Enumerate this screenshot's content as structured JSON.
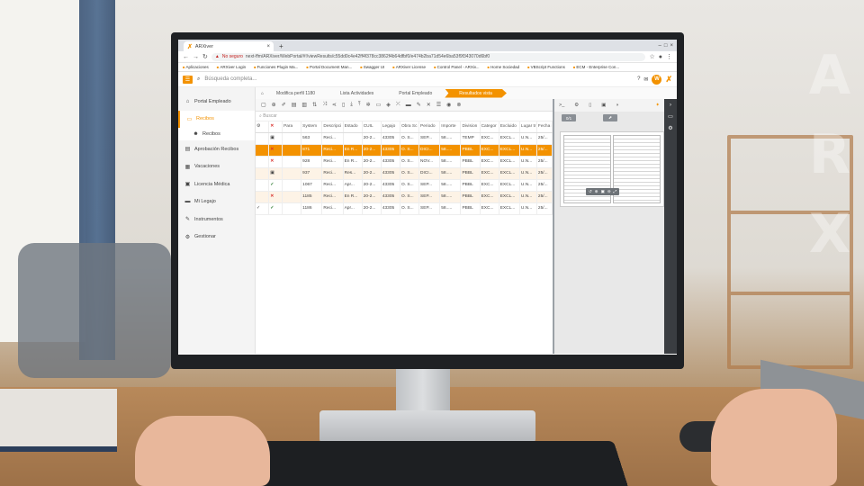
{
  "browser": {
    "tab_title": "ARXiver",
    "not_secure": "No seguro",
    "url": "next-ffm/ARXiver/WebPortal/#!/viewResults/c55dd0c4e42ff4f378cc3862f4b64dfbf0/e474b2ba71d54e6ba53f9f343070d6bf0",
    "bookmarks": [
      "Aplicaciones",
      "ARXiver Login",
      "Funciones Plugin Ma...",
      "Portal Document Man...",
      "Swagger UI",
      "ARXiver License",
      "Control Panel - ARXiv...",
      "Home Sociedad",
      "VBScript Functions",
      "ECM - Enterprise Con..."
    ]
  },
  "header": {
    "search_placeholder": "Búsqueda completa...",
    "avatar_letter": "W"
  },
  "sidebar": {
    "items": [
      {
        "label": "Portal Empleado",
        "icon": "home-icon"
      },
      {
        "label": "Recibos",
        "icon": "folder-icon",
        "active": true
      },
      {
        "label": "Aprobación Recibos",
        "icon": "approval-icon"
      },
      {
        "label": "Vacaciones",
        "icon": "calendar-icon"
      },
      {
        "label": "Licencia Médica",
        "icon": "medical-icon"
      },
      {
        "label": "Mi Legajo",
        "icon": "file-icon"
      },
      {
        "label": "Instrumentos",
        "icon": "wrench-icon"
      },
      {
        "label": "Gestionar",
        "icon": "gears-icon"
      }
    ],
    "sub_item": "Recibos"
  },
  "breadcrumbs": [
    "Modifica perfil 1180",
    "Lista Actividades",
    "Portal Empleado",
    "Resultados vista"
  ],
  "grid": {
    "search_placeholder": "Buscar",
    "columns": [
      "",
      "",
      "Para",
      "System",
      "Descripci",
      "Estado",
      "CUIL",
      "Legajo",
      "Obra Sc",
      "Periodo",
      "Importe",
      "Division",
      "Categor",
      "Excluido",
      "Lugar tr",
      "Fecha i"
    ],
    "rows": [
      {
        "status": "lock",
        "cells": [
          "563",
          "Reci...",
          "",
          "20-2...",
          "43305",
          "O. S...",
          "SEP...",
          "58.....",
          "TEMP",
          "EXC...",
          "EXCL...",
          "U.N...",
          "25/..."
        ]
      },
      {
        "status": "x",
        "selected": true,
        "cells": [
          "871",
          "Reci...",
          "En R...",
          "20-2...",
          "43305",
          "O. S...",
          "DICI...",
          "58.....",
          "PBBL",
          "EXC...",
          "EXCL...",
          "U.N...",
          "25/..."
        ]
      },
      {
        "status": "x",
        "cells": [
          "928",
          "Reci...",
          "En R...",
          "20-2...",
          "43305",
          "O. S...",
          "NOV...",
          "58.....",
          "PBBL",
          "EXC...",
          "EXCL...",
          "U.N...",
          "25/..."
        ]
      },
      {
        "status": "lock",
        "alt": true,
        "cells": [
          "937",
          "Reci...",
          "Res...",
          "20-2...",
          "43305",
          "O. S...",
          "DICI...",
          "58.....",
          "PBBL",
          "EXC...",
          "EXCL...",
          "U.N...",
          "25/..."
        ]
      },
      {
        "status": "check",
        "cells": [
          "1067",
          "Reci...",
          "Apr...",
          "20-2...",
          "43305",
          "O. S...",
          "SEP...",
          "58.....",
          "PBBL",
          "EXC...",
          "EXCL...",
          "U.N...",
          "25/..."
        ]
      },
      {
        "status": "x",
        "alt": true,
        "cells": [
          "1185",
          "Reci...",
          "En R...",
          "20-2...",
          "43305",
          "O. S...",
          "SEP...",
          "58.....",
          "PBBL",
          "EXC...",
          "EXCL...",
          "U.N...",
          "25/..."
        ]
      },
      {
        "status": "check",
        "pre": "✓",
        "cells": [
          "1186",
          "Reci...",
          "Apr...",
          "20-2...",
          "43305",
          "O. S...",
          "SEP...",
          "58.....",
          "PBBL",
          "EXC...",
          "EXCL...",
          "U.N...",
          "25/..."
        ]
      }
    ]
  },
  "preview": {
    "page_label": "0/1"
  },
  "brand_letters": [
    "A",
    "R",
    "X"
  ],
  "colors": {
    "accent": "#f39200",
    "danger": "#d9302c",
    "success": "#2e7d32"
  }
}
